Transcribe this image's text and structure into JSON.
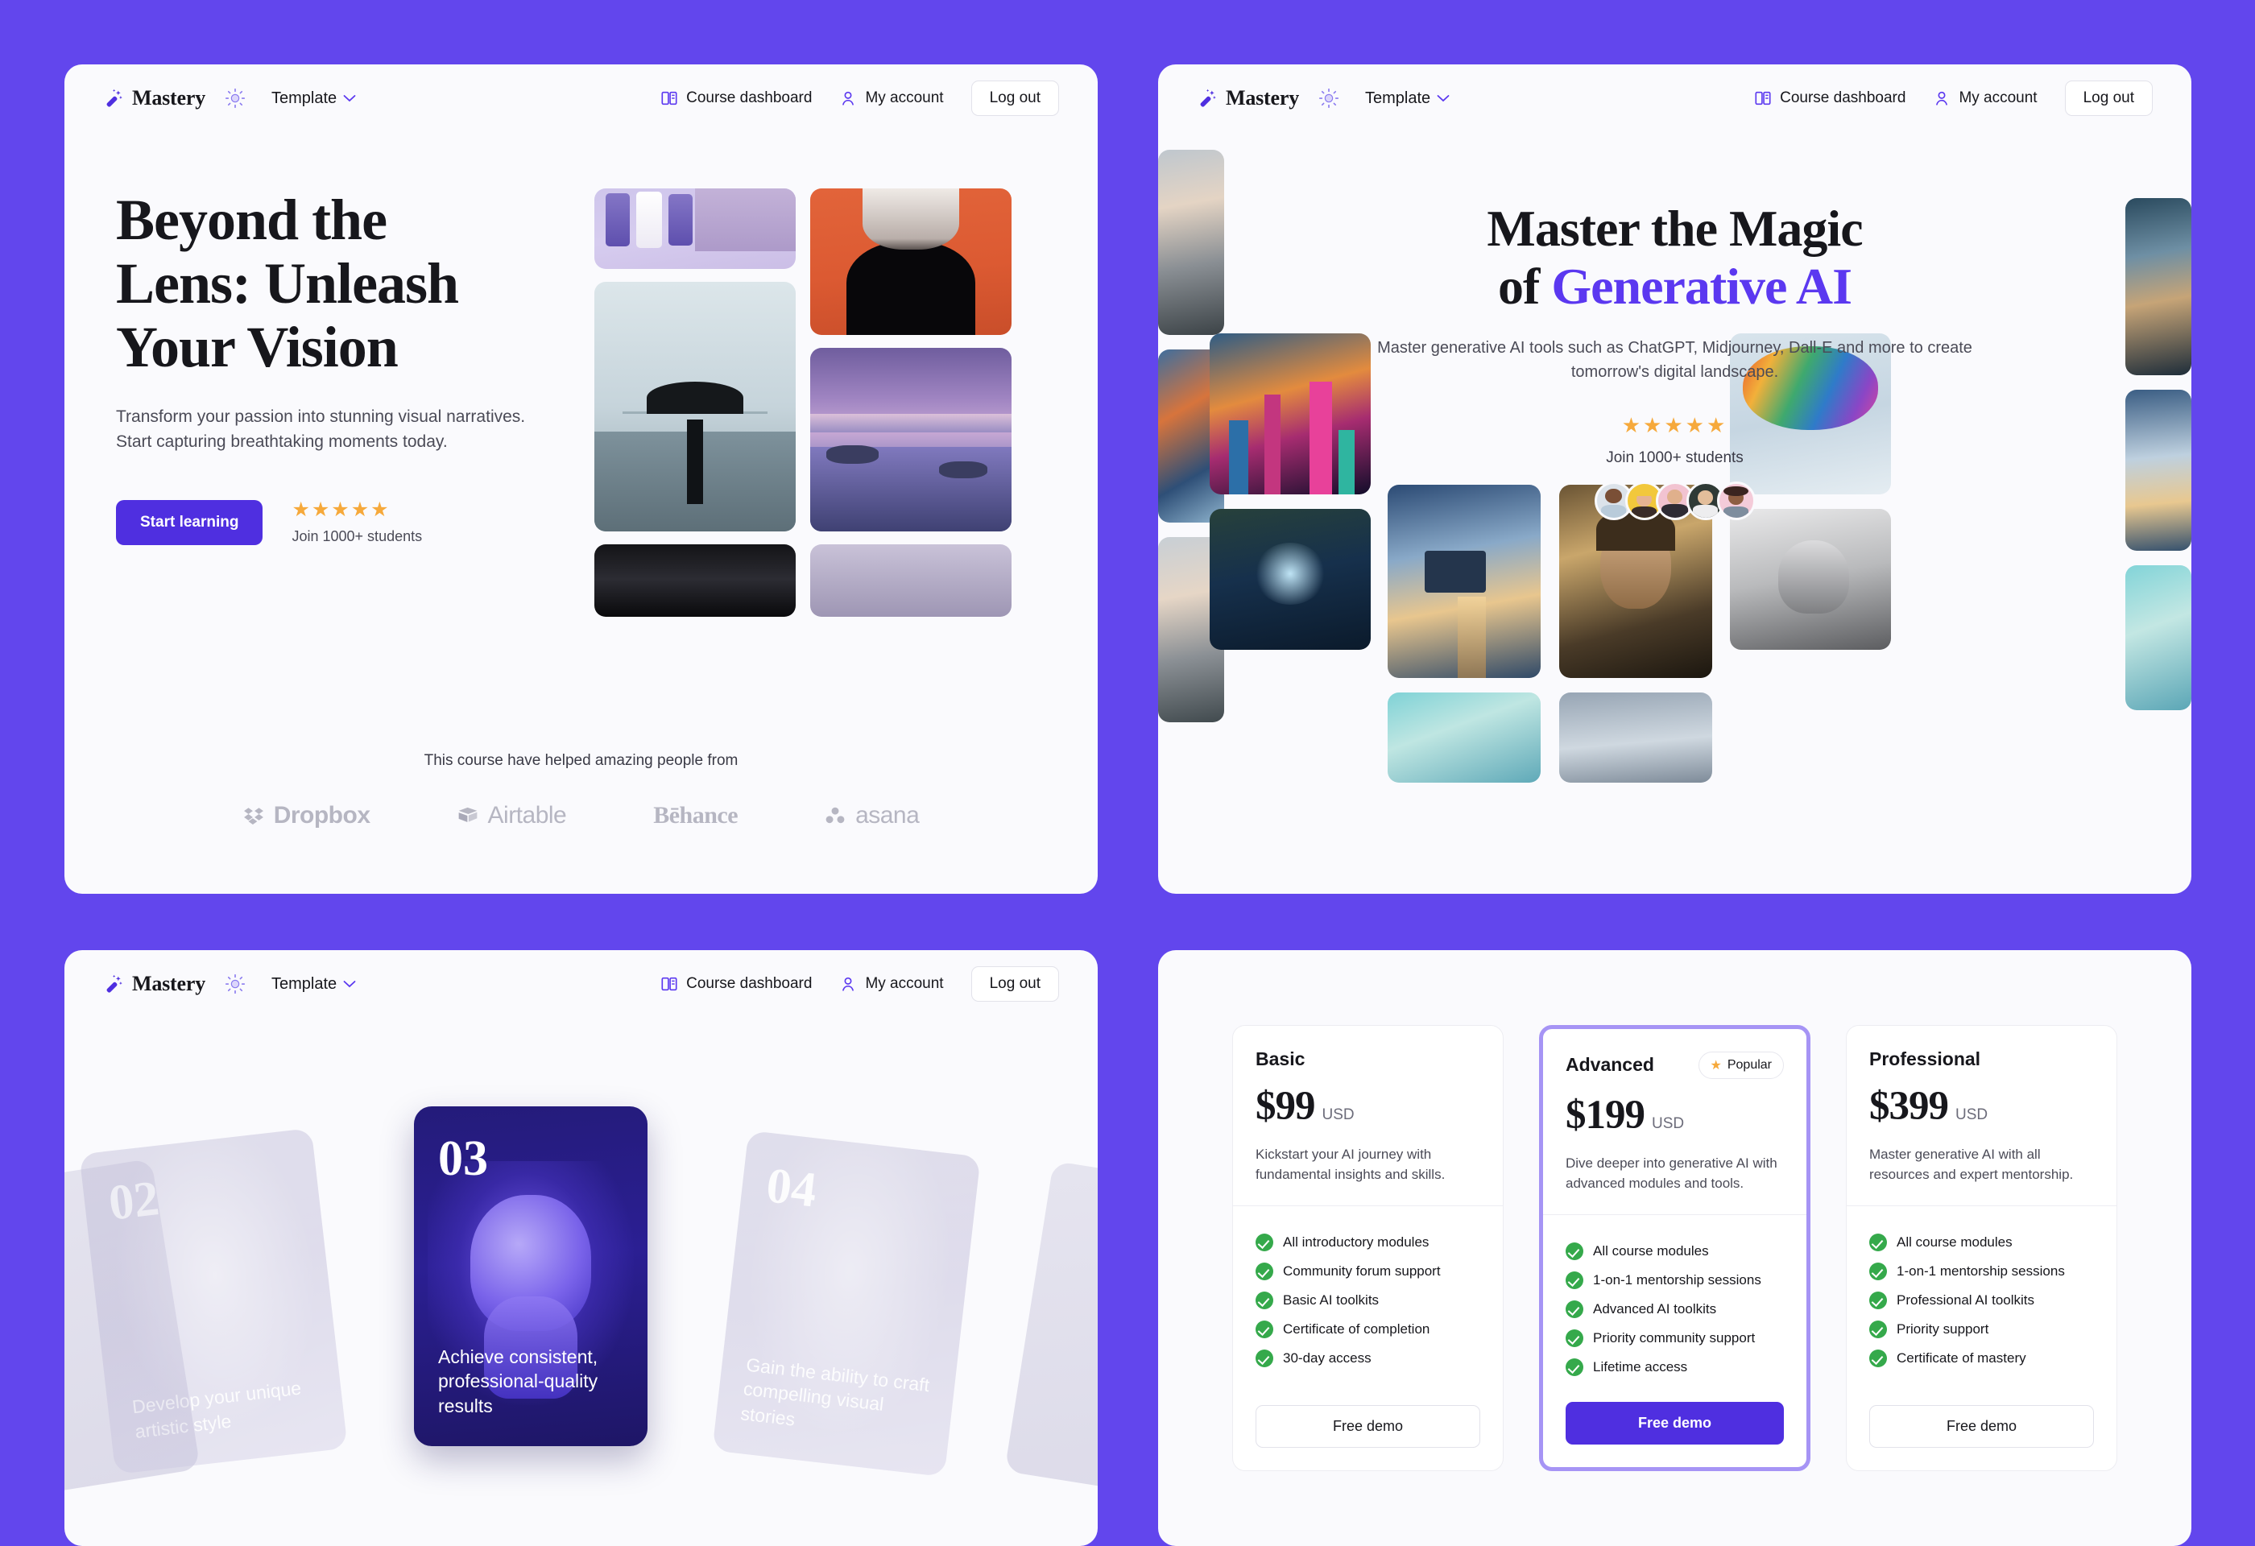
{
  "theme": {
    "page_background": "#6246ED",
    "panel_background": "#FAFAFD",
    "accent": "#4F2FE0",
    "accent_text": "#5B38F0",
    "star_color": "#F6A93B",
    "check_color": "#35A94B",
    "featured_border": "#A694F5"
  },
  "navbar": {
    "brand": "Mastery",
    "brand_icon": "magic-wand-icon",
    "theme_toggle_icon": "sun-icon",
    "template_label": "Template",
    "template_chevron_icon": "chevron-down-icon",
    "course_dashboard_label": "Course dashboard",
    "course_dashboard_icon": "book-icon",
    "my_account_label": "My account",
    "my_account_icon": "user-icon",
    "logout_label": "Log out"
  },
  "hero_photo": {
    "title_lines": [
      "Beyond the",
      "Lens: Unleash",
      "Your Vision"
    ],
    "subtitle": "Transform your passion into stunning visual narratives. Start capturing breathtaking moments today.",
    "cta_label": "Start learning",
    "stars": "★★★★★",
    "rating_count": 5,
    "social_proof": "Join 1000+ students",
    "gallery": [
      {
        "name": "skincare-products-photo",
        "alt": "Curology skincare tubes on lavender background"
      },
      {
        "name": "orange-portrait-photo",
        "alt": "Silhouette portrait on orange gradient"
      },
      {
        "name": "umbrella-bridge-photo",
        "alt": "Person with black umbrella before a foggy bridge"
      },
      {
        "name": "purple-seascape-photo",
        "alt": "Purple twilight seascape with lighthouse"
      },
      {
        "name": "dark-reflection-photo",
        "alt": "Dark monochrome reflection"
      },
      {
        "name": "bottom-strip-photo",
        "alt": "Partially visible photo strip"
      }
    ],
    "logos_title": "This course have helped amazing people from",
    "logos": [
      {
        "name": "Dropbox",
        "icon": "dropbox-icon"
      },
      {
        "name": "Airtable",
        "icon": "airtable-icon"
      },
      {
        "name": "Behance",
        "icon": "behance-icon"
      },
      {
        "name": "asana",
        "icon": "asana-icon"
      }
    ]
  },
  "hero_ai": {
    "title_line1": "Master the Magic",
    "title_line2_prefix": "of ",
    "title_line2_accent": "Generative AI",
    "subtitle": "Master generative AI tools such as ChatGPT, Midjourney, Dall-E and more to create tomorrow's digital landscape.",
    "stars": "★★★★★",
    "rating_count": 5,
    "social_proof": "Join 1000+ students",
    "avatars": [
      {
        "name": "avatar-1",
        "alt": "Smiling man in light shirt"
      },
      {
        "name": "avatar-2",
        "alt": "Woman in yellow hat"
      },
      {
        "name": "avatar-3",
        "alt": "Bearded man with glasses"
      },
      {
        "name": "avatar-4",
        "alt": "Grey-haired smiling man"
      },
      {
        "name": "avatar-5",
        "alt": "Woman with curly hair"
      }
    ],
    "gallery": [
      {
        "name": "misty-mountains-art",
        "alt": "Sunrays over misty mountain valley"
      },
      {
        "name": "isometric-city-art",
        "alt": "Colourful isometric city illustration"
      },
      {
        "name": "misty-mountains-art-2",
        "alt": "Sunrays over misty mountains repeated"
      },
      {
        "name": "neon-cityscape-art",
        "alt": "Neon cyberpunk city at sunset with flying ships"
      },
      {
        "name": "enchanted-forest-art",
        "alt": "Enchanted glowing forest with fairy"
      },
      {
        "name": "floating-islands-art",
        "alt": "Floating islands above a golden sea"
      },
      {
        "name": "romantic-portrait-art",
        "alt": "Dramatic portrait of a man amid storm clouds"
      },
      {
        "name": "colour-swirl-art",
        "alt": "Abstract colourful swirling sculpture"
      },
      {
        "name": "pencil-portrait-art",
        "alt": "Monochrome pencil portrait of bearded man"
      },
      {
        "name": "teal-city-art",
        "alt": "Teal stylised city illustration"
      },
      {
        "name": "cosmic-landscape-art",
        "alt": "Cosmic painterly landscape"
      },
      {
        "name": "cloudscape-art",
        "alt": "Soft cloudscape"
      }
    ]
  },
  "steps": {
    "cards": [
      {
        "number": "02",
        "text": "Develop your unique artistic style",
        "image_name": "step-card-photo-02",
        "image_alt": "Portrait of woman with headphones, ghosted",
        "state": "inactive"
      },
      {
        "number": "03",
        "text": "Achieve consistent, professional-quality results",
        "image_name": "step-card-photo-03",
        "image_alt": "Classical marble bust in purple duotone",
        "state": "active"
      },
      {
        "number": "04",
        "text": "Gain the ability to craft compelling visual stories",
        "image_name": "step-card-photo-04",
        "image_alt": "Woman with arms folded, ghosted",
        "state": "inactive"
      }
    ]
  },
  "pricing": {
    "plans": [
      {
        "name": "Basic",
        "price": "$99",
        "currency": "USD",
        "badge": null,
        "description": "Kickstart your AI journey with fundamental insights and skills.",
        "features": [
          "All introductory modules",
          "Community forum support",
          "Basic AI toolkits",
          "Certificate of completion",
          "30-day access"
        ],
        "cta_label": "Free demo",
        "featured": false
      },
      {
        "name": "Advanced",
        "price": "$199",
        "currency": "USD",
        "badge": "Popular",
        "badge_icon": "star-icon",
        "description": "Dive deeper into generative AI with advanced modules and tools.",
        "features": [
          "All course modules",
          "1-on-1 mentorship sessions",
          "Advanced AI toolkits",
          "Priority community support",
          "Lifetime access"
        ],
        "cta_label": "Free demo",
        "featured": true
      },
      {
        "name": "Professional",
        "price": "$399",
        "currency": "USD",
        "badge": null,
        "description": "Master generative AI with all resources and expert mentorship.",
        "features": [
          "All course modules",
          "1-on-1 mentorship sessions",
          "Professional AI toolkits",
          "Priority support",
          "Certificate of mastery"
        ],
        "cta_label": "Free demo",
        "featured": false
      }
    ]
  }
}
